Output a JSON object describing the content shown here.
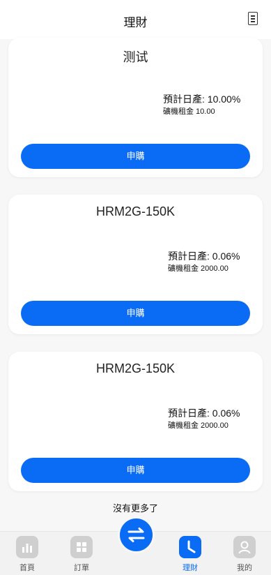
{
  "header": {
    "title": "理財"
  },
  "products": [
    {
      "name": "测试",
      "rate": "預計日產: 10.00%",
      "rent": "礦機租金 10.00",
      "button": "申購"
    },
    {
      "name": "HRM2G-150K",
      "rate": "預計日產: 0.06%",
      "rent": "礦機租金 2000.00",
      "button": "申購"
    },
    {
      "name": "HRM2G-150K",
      "rate": "預計日產: 0.06%",
      "rent": "礦機租金 2000.00",
      "button": "申購"
    }
  ],
  "footer_note": "沒有更多了",
  "tabbar": {
    "items": [
      {
        "label": "首頁",
        "icon": "chart-icon"
      },
      {
        "label": "訂單",
        "icon": "grid-icon"
      },
      {
        "label": "理財",
        "icon": "clock-icon",
        "active": true
      },
      {
        "label": "我的",
        "icon": "user-icon"
      }
    ],
    "center_icon": "swap-arrows-icon"
  },
  "colors": {
    "accent": "#0a6bf5",
    "background": "#f7f7f7",
    "card": "#ffffff",
    "tab_inactive": "#cfcfcf"
  }
}
